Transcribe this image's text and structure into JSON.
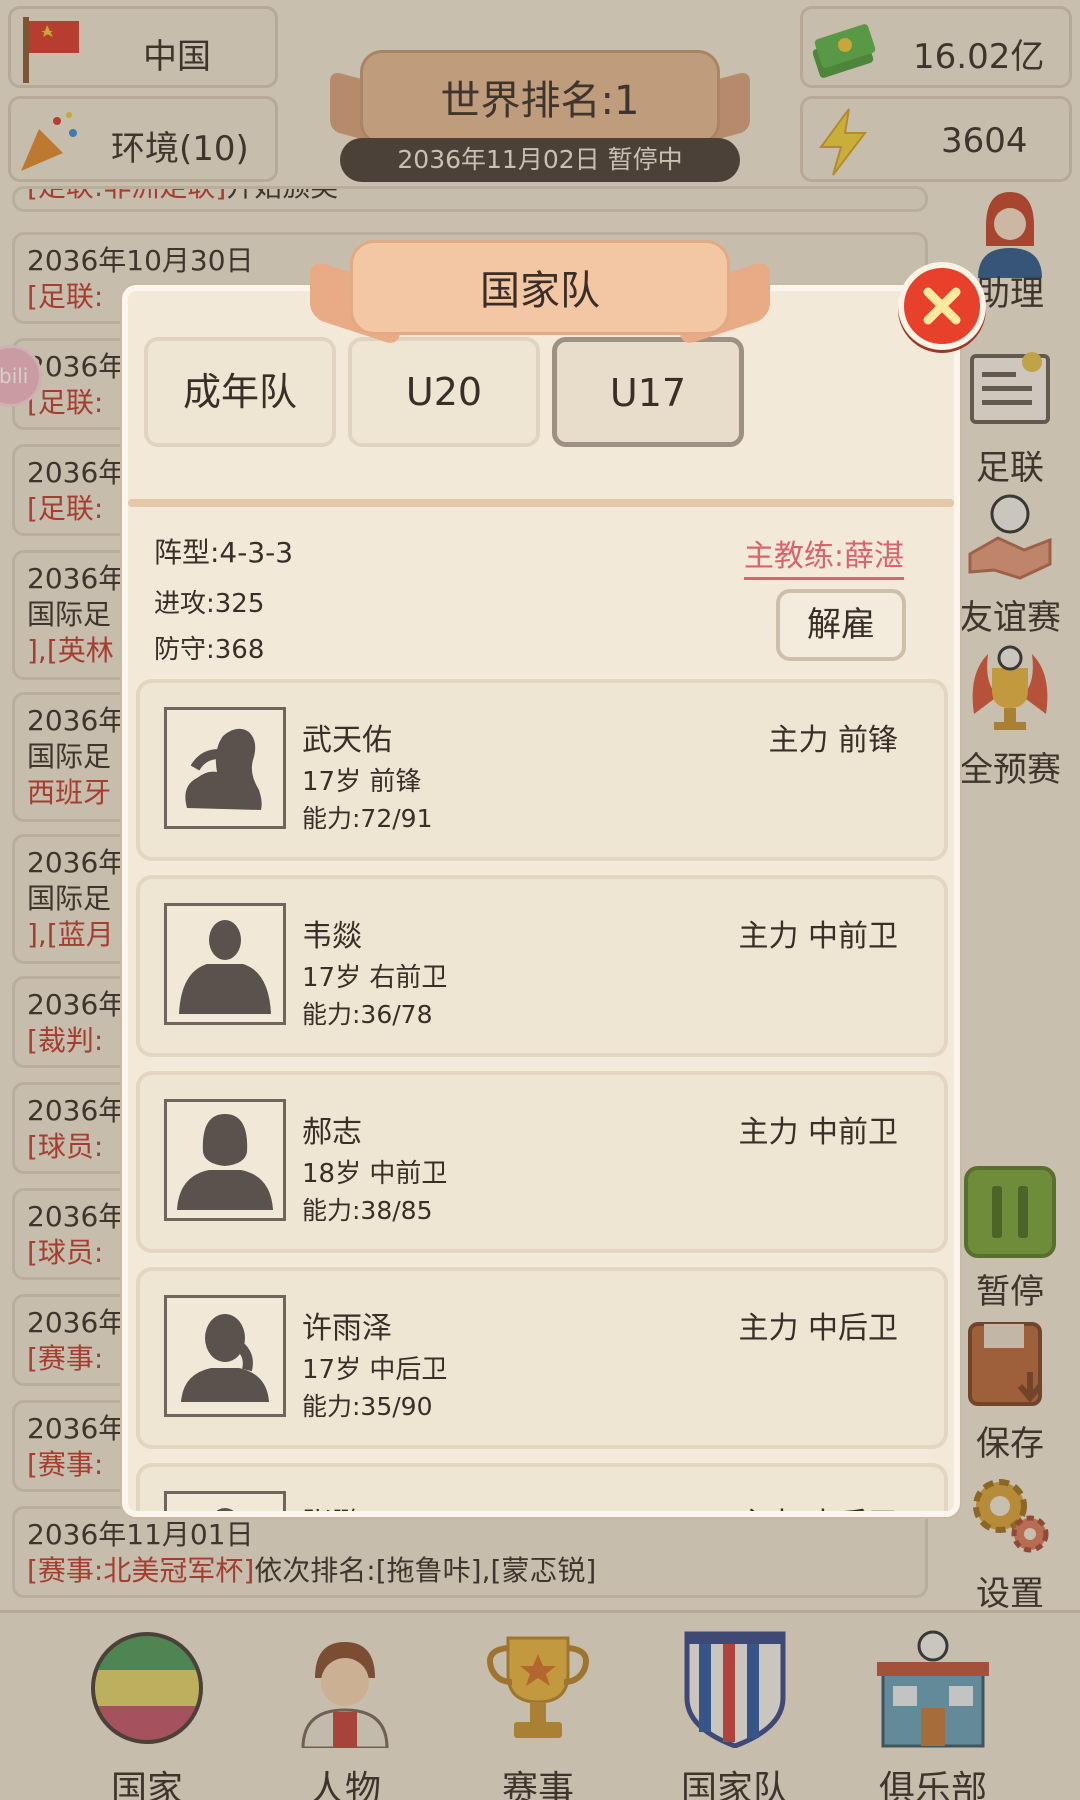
{
  "header": {
    "country": "中国",
    "environment": "环境(10)",
    "rank_title": "世界排名:1",
    "date_status": "2036年11月02日  暂停中",
    "money": "16.02亿",
    "energy": "3604"
  },
  "news_log": [
    {
      "date": "",
      "tag": "[足联:非洲足联]",
      "text": "开始颁奖"
    },
    {
      "date": "2036年10月30日",
      "tag": "[足联:",
      "text": ""
    },
    {
      "date": "2036年",
      "tag": "[足联:",
      "text": ""
    },
    {
      "date": "2036年",
      "tag": "[足联:",
      "text": ""
    },
    {
      "date": "2036年",
      "line2": "国际足",
      "tag": "],[英林",
      "text": ""
    },
    {
      "date": "2036年",
      "line2": "国际足",
      "tag": "西班牙",
      "text": ""
    },
    {
      "date": "2036年",
      "line2": "国际足",
      "tag": "],[蓝月",
      "text": ""
    },
    {
      "date": "2036年",
      "tag": "[裁判:",
      "text": ""
    },
    {
      "date": "2036年",
      "tag": "[球员:",
      "text": ""
    },
    {
      "date": "2036年",
      "tag": "[球员:",
      "text": ""
    },
    {
      "date": "2036年",
      "tag": "[赛事:",
      "text": ""
    },
    {
      "date": "2036年",
      "tag": "[赛事:",
      "text": ""
    },
    {
      "date": "2036年11月01日",
      "tag": "[赛事:北美冠军杯]",
      "text": "依次排名:[拖鲁咔],[蒙忑锐]"
    }
  ],
  "side_menu": [
    "助理",
    "足联",
    "友谊赛",
    "全预赛",
    "暂停",
    "保存",
    "设置"
  ],
  "bottom_nav": [
    "国家",
    "人物",
    "赛事",
    "国家队",
    "俱乐部"
  ],
  "bili_badge": "bili",
  "modal": {
    "title": "国家队",
    "tabs": [
      "成年队",
      "U20",
      "U17"
    ],
    "active_tab": "U17",
    "formation": "阵型:4-3-3",
    "attack": "进攻:325",
    "defense": "防守:368",
    "coach": "主教练:薛湛",
    "fire_label": "解雇",
    "players": [
      {
        "name": "武天佑",
        "age_pos": "17岁  前锋",
        "ability": "能力:72/91",
        "role": "主力  前锋"
      },
      {
        "name": "韦燚",
        "age_pos": "17岁  右前卫",
        "ability": "能力:36/78",
        "role": "主力  中前卫"
      },
      {
        "name": "郝志",
        "age_pos": "18岁  中前卫",
        "ability": "能力:38/85",
        "role": "主力  中前卫"
      },
      {
        "name": "许雨泽",
        "age_pos": "17岁  中后卫",
        "ability": "能力:35/90",
        "role": "主力  中后卫"
      },
      {
        "name": "张鹏",
        "age_pos": "",
        "ability": "",
        "role": "主力  中后卫"
      }
    ]
  },
  "colors": {
    "accent_red": "#c23b2e",
    "coach_pink": "#d9646b",
    "close_red": "#e8412b",
    "pause_green": "#7aa33a"
  }
}
